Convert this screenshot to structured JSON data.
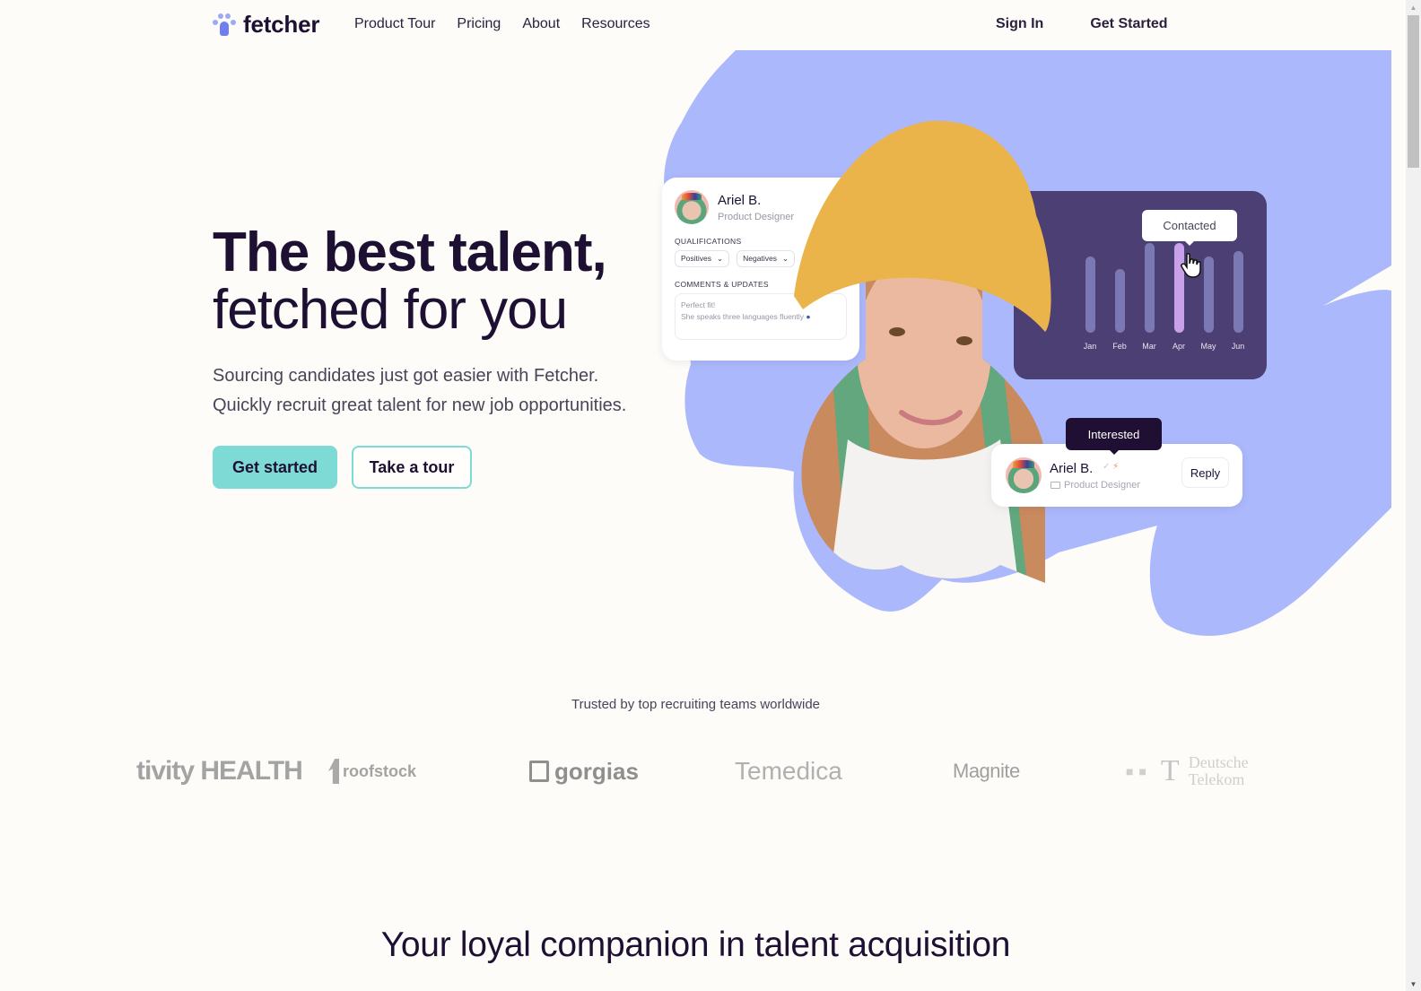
{
  "nav": {
    "brand": "fetcher",
    "links": [
      "Product Tour",
      "Pricing",
      "About",
      "Resources"
    ],
    "sign_in": "Sign In",
    "get_started": "Get Started"
  },
  "hero": {
    "title_line1": "The best talent,",
    "title_line2": "fetched for you",
    "subtitle_line1": "Sourcing candidates just got easier with Fetcher.",
    "subtitle_line2": "Quickly recruit great talent for new job opportunities.",
    "primary_cta": "Get started",
    "secondary_cta": "Take a tour"
  },
  "profile_card": {
    "name": "Ariel B.",
    "role": "Product Designer",
    "qualifications_label": "QUALIFICATIONS",
    "chips": [
      "Positives",
      "Negatives"
    ],
    "comments_label": "COMMENTS & UPDATES",
    "comment_line1": "Perfect fit!",
    "comment_line2": "She speaks three languages fluently"
  },
  "activity_chart": {
    "tooltip": "Contacted",
    "months": [
      "Jan",
      "Feb",
      "Mar",
      "Apr",
      "May",
      "Jun"
    ],
    "relative_levels": [
      0.72,
      0.6,
      0.85,
      0.85,
      0.72,
      0.77
    ],
    "highlighted": "Apr",
    "bar_color": "#7a79b3",
    "highlight_color": "#c9a0ea"
  },
  "message_card": {
    "tooltip": "Interested",
    "name": "Ariel B.",
    "role": "Product Designer",
    "reply_label": "Reply"
  },
  "trusted": {
    "heading": "Trusted by top recruiting teams worldwide",
    "logos": [
      "tivity HEALTH",
      "roofstock",
      "gorgias",
      "Temedica",
      "Magnite",
      "Deutsche Telekom"
    ]
  },
  "section2": {
    "heading": "Your loyal companion in talent acquisition"
  },
  "colors": {
    "brand_dark": "#1e1033",
    "accent_teal": "#7ddad4",
    "blob": "#abb8fb",
    "chart_card": "#4b3f73"
  }
}
